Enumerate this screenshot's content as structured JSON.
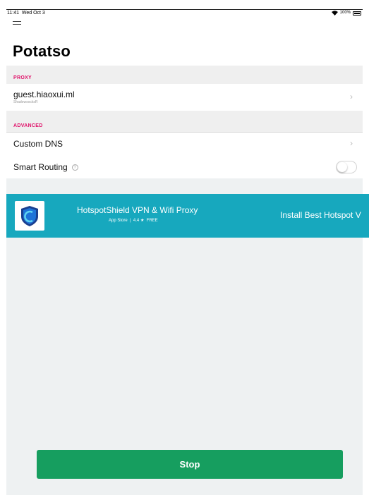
{
  "status_bar": {
    "time": "11:41",
    "date": "Wed Oct 3",
    "battery_percent": "100%"
  },
  "header": {
    "title": "Potatso"
  },
  "proxy_section": {
    "header": "PROXY",
    "item": {
      "name": "guest.hiaoxui.ml",
      "type": "ShadowsocksR"
    }
  },
  "advanced_section": {
    "header": "ADVANCED",
    "custom_dns_label": "Custom DNS",
    "smart_routing_label": "Smart Routing",
    "smart_routing_on": false
  },
  "ad": {
    "title": "HotspotShield VPN & Wifi Proxy",
    "store": "App Store",
    "rating": "4.4",
    "price": "FREE",
    "cta": "Install Best Hotspot V"
  },
  "controls": {
    "stop_label": "Stop"
  },
  "colors": {
    "section_header_text": "#e0126a",
    "ad_background": "#17a8be",
    "stop_button": "#169e5f",
    "background_gray": "#eef1f2"
  }
}
